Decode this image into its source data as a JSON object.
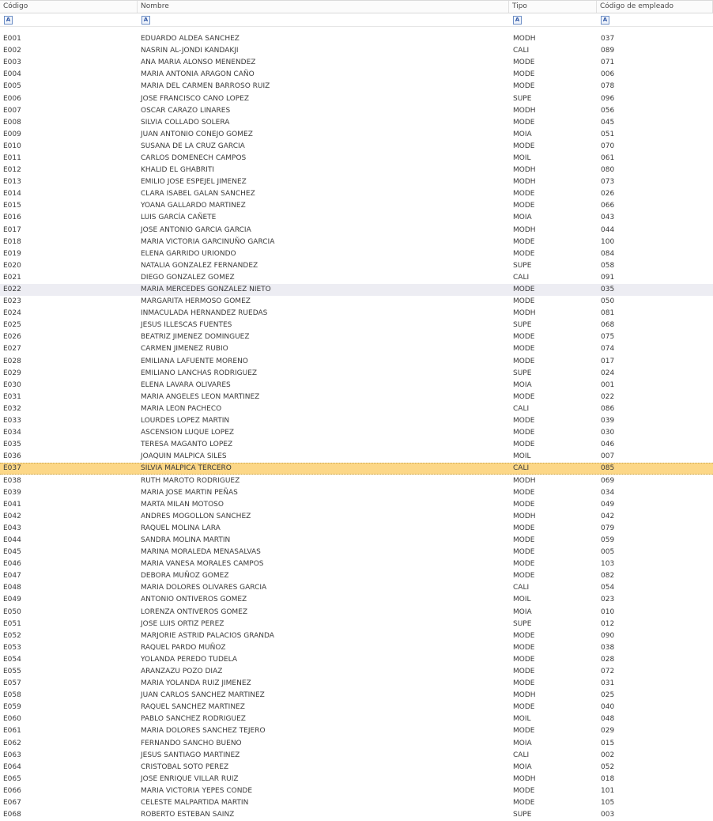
{
  "columns": {
    "codigo": "Código",
    "nombre": "Nombre",
    "tipo": "Tipo",
    "codigo_empleado": "Código de empleado"
  },
  "filter_icon_glyph": "A",
  "selected_codigo": "E037",
  "hover_codigo": "E022",
  "colors": {
    "selected_row": "#fcd787",
    "hover_row": "#ededf3",
    "filter_icon": "#2f56a4"
  },
  "rows": [
    {
      "codigo": "E001",
      "nombre": "EDUARDO ALDEA SANCHEZ",
      "tipo": "MODH",
      "emp": "037"
    },
    {
      "codigo": "E002",
      "nombre": "NASRIN AL-JONDI KANDAKJI",
      "tipo": "CALI",
      "emp": "089"
    },
    {
      "codigo": "E003",
      "nombre": "ANA MARIA ALONSO MENENDEZ",
      "tipo": "MODE",
      "emp": "071"
    },
    {
      "codigo": "E004",
      "nombre": "MARIA ANTONIA ARAGON CAÑO",
      "tipo": "MODE",
      "emp": "006"
    },
    {
      "codigo": "E005",
      "nombre": "MARIA DEL CARMEN BARROSO RUIZ",
      "tipo": "MODE",
      "emp": "078"
    },
    {
      "codigo": "E006",
      "nombre": "JOSE FRANCISCO CANO LOPEZ",
      "tipo": "SUPE",
      "emp": "096"
    },
    {
      "codigo": "E007",
      "nombre": "OSCAR CARAZO LINARES",
      "tipo": "MODH",
      "emp": "056"
    },
    {
      "codigo": "E008",
      "nombre": "SILVIA COLLADO SOLERA",
      "tipo": "MODE",
      "emp": "045"
    },
    {
      "codigo": "E009",
      "nombre": "JUAN ANTONIO CONEJO GOMEZ",
      "tipo": "MOIA",
      "emp": "051"
    },
    {
      "codigo": "E010",
      "nombre": "SUSANA DE LA CRUZ GARCIA",
      "tipo": "MODE",
      "emp": "070"
    },
    {
      "codigo": "E011",
      "nombre": "CARLOS DOMENECH CAMPOS",
      "tipo": "MOIL",
      "emp": "061"
    },
    {
      "codigo": "E012",
      "nombre": "KHALID EL GHABRITI",
      "tipo": "MODH",
      "emp": "080"
    },
    {
      "codigo": "E013",
      "nombre": "EMILIO JOSE ESPEJEL JIMENEZ",
      "tipo": "MODH",
      "emp": "073"
    },
    {
      "codigo": "E014",
      "nombre": "CLARA ISABEL GALAN SANCHEZ",
      "tipo": "MODE",
      "emp": "026"
    },
    {
      "codigo": "E015",
      "nombre": "YOANA GALLARDO MARTINEZ",
      "tipo": "MODE",
      "emp": "066"
    },
    {
      "codigo": "E016",
      "nombre": "LUIS GARCÍA CAÑETE",
      "tipo": "MOIA",
      "emp": "043"
    },
    {
      "codigo": "E017",
      "nombre": "JOSE ANTONIO GARCIA GARCIA",
      "tipo": "MODH",
      "emp": "044"
    },
    {
      "codigo": "E018",
      "nombre": "MARIA VICTORIA GARCINUÑO GARCIA",
      "tipo": "MODE",
      "emp": "100"
    },
    {
      "codigo": "E019",
      "nombre": "ELENA GARRIDO URIONDO",
      "tipo": "MODE",
      "emp": "084"
    },
    {
      "codigo": "E020",
      "nombre": "NATALIA GONZALEZ FERNANDEZ",
      "tipo": "SUPE",
      "emp": "058"
    },
    {
      "codigo": "E021",
      "nombre": "DIEGO GONZALEZ GOMEZ",
      "tipo": "CALI",
      "emp": "091"
    },
    {
      "codigo": "E022",
      "nombre": "MARIA MERCEDES GONZALEZ NIETO",
      "tipo": "MODE",
      "emp": "035"
    },
    {
      "codigo": "E023",
      "nombre": "MARGARITA HERMOSO GOMEZ",
      "tipo": "MODE",
      "emp": "050"
    },
    {
      "codigo": "E024",
      "nombre": "INMACULADA HERNANDEZ RUEDAS",
      "tipo": "MODH",
      "emp": "081"
    },
    {
      "codigo": "E025",
      "nombre": "JESUS ILLESCAS FUENTES",
      "tipo": "SUPE",
      "emp": "068"
    },
    {
      "codigo": "E026",
      "nombre": "BEATRIZ JIMENEZ DOMINGUEZ",
      "tipo": "MODE",
      "emp": "075"
    },
    {
      "codigo": "E027",
      "nombre": "CARMEN JIMENEZ RUBIO",
      "tipo": "MODE",
      "emp": "074"
    },
    {
      "codigo": "E028",
      "nombre": "EMILIANA LAFUENTE MORENO",
      "tipo": "MODE",
      "emp": "017"
    },
    {
      "codigo": "E029",
      "nombre": "EMILIANO LANCHAS RODRIGUEZ",
      "tipo": "SUPE",
      "emp": "024"
    },
    {
      "codigo": "E030",
      "nombre": "ELENA LAVARA OLIVARES",
      "tipo": "MOIA",
      "emp": "001"
    },
    {
      "codigo": "E031",
      "nombre": "MARIA ANGELES LEON MARTINEZ",
      "tipo": "MODE",
      "emp": "022"
    },
    {
      "codigo": "E032",
      "nombre": "MARIA LEON PACHECO",
      "tipo": "CALI",
      "emp": "086"
    },
    {
      "codigo": "E033",
      "nombre": "LOURDES LOPEZ MARTIN",
      "tipo": "MODE",
      "emp": "039"
    },
    {
      "codigo": "E034",
      "nombre": "ASCENSION LUQUE LOPEZ",
      "tipo": "MODE",
      "emp": "030"
    },
    {
      "codigo": "E035",
      "nombre": "TERESA MAGANTO LOPEZ",
      "tipo": "MODE",
      "emp": "046"
    },
    {
      "codigo": "E036",
      "nombre": "JOAQUIN MALPICA SILES",
      "tipo": "MOIL",
      "emp": "007"
    },
    {
      "codigo": "E037",
      "nombre": "SILVIA MALPICA TERCERO",
      "tipo": "CALI",
      "emp": "085"
    },
    {
      "codigo": "E038",
      "nombre": "RUTH MAROTO RODRIGUEZ",
      "tipo": "MODH",
      "emp": "069"
    },
    {
      "codigo": "E039",
      "nombre": "MARIA JOSE MARTIN PEÑAS",
      "tipo": "MODE",
      "emp": "034"
    },
    {
      "codigo": "E041",
      "nombre": "MARTA MILAN MOTOSO",
      "tipo": "MODE",
      "emp": "049"
    },
    {
      "codigo": "E042",
      "nombre": "ANDRES MOGOLLON SANCHEZ",
      "tipo": "MODH",
      "emp": "042"
    },
    {
      "codigo": "E043",
      "nombre": "RAQUEL MOLINA LARA",
      "tipo": "MODE",
      "emp": "079"
    },
    {
      "codigo": "E044",
      "nombre": "SANDRA MOLINA MARTIN",
      "tipo": "MODE",
      "emp": "059"
    },
    {
      "codigo": "E045",
      "nombre": "MARINA MORALEDA MENASALVAS",
      "tipo": "MODE",
      "emp": "005"
    },
    {
      "codigo": "E046",
      "nombre": "MARIA VANESA MORALES CAMPOS",
      "tipo": "MODE",
      "emp": "103"
    },
    {
      "codigo": "E047",
      "nombre": "DEBORA MUÑOZ GOMEZ",
      "tipo": "MODE",
      "emp": "082"
    },
    {
      "codigo": "E048",
      "nombre": "MARIA DOLORES OLIVARES GARCIA",
      "tipo": "CALI",
      "emp": "054"
    },
    {
      "codigo": "E049",
      "nombre": "ANTONIO ONTIVEROS GOMEZ",
      "tipo": "MOIL",
      "emp": "023"
    },
    {
      "codigo": "E050",
      "nombre": "LORENZA ONTIVEROS GOMEZ",
      "tipo": "MOIA",
      "emp": "010"
    },
    {
      "codigo": "E051",
      "nombre": "JOSE LUIS ORTIZ PEREZ",
      "tipo": "SUPE",
      "emp": "012"
    },
    {
      "codigo": "E052",
      "nombre": "MARJORIE ASTRID PALACIOS GRANDA",
      "tipo": "MODE",
      "emp": "090"
    },
    {
      "codigo": "E053",
      "nombre": "RAQUEL PARDO MUÑOZ",
      "tipo": "MODE",
      "emp": "038"
    },
    {
      "codigo": "E054",
      "nombre": "YOLANDA PEREDO TUDELA",
      "tipo": "MODE",
      "emp": "028"
    },
    {
      "codigo": "E055",
      "nombre": "ARANZAZU POZO DIAZ",
      "tipo": "MODE",
      "emp": "072"
    },
    {
      "codigo": "E057",
      "nombre": "MARIA YOLANDA RUIZ JIMENEZ",
      "tipo": "MODE",
      "emp": "031"
    },
    {
      "codigo": "E058",
      "nombre": "JUAN CARLOS SANCHEZ MARTINEZ",
      "tipo": "MODH",
      "emp": "025"
    },
    {
      "codigo": "E059",
      "nombre": "RAQUEL SANCHEZ MARTINEZ",
      "tipo": "MODE",
      "emp": "040"
    },
    {
      "codigo": "E060",
      "nombre": "PABLO SANCHEZ RODRIGUEZ",
      "tipo": "MOIL",
      "emp": "048"
    },
    {
      "codigo": "E061",
      "nombre": "MARIA DOLORES SANCHEZ TEJERO",
      "tipo": "MODE",
      "emp": "029"
    },
    {
      "codigo": "E062",
      "nombre": "FERNANDO SANCHO BUENO",
      "tipo": "MOIA",
      "emp": "015"
    },
    {
      "codigo": "E063",
      "nombre": "JESUS SANTIAGO MARTINEZ",
      "tipo": "CALI",
      "emp": "002"
    },
    {
      "codigo": "E064",
      "nombre": "CRISTOBAL SOTO PEREZ",
      "tipo": "MOIA",
      "emp": "052"
    },
    {
      "codigo": "E065",
      "nombre": "JOSE ENRIQUE VILLAR RUIZ",
      "tipo": "MODH",
      "emp": "018"
    },
    {
      "codigo": "E066",
      "nombre": "MARIA VICTORIA YEPES CONDE",
      "tipo": "MODE",
      "emp": "101"
    },
    {
      "codigo": "E067",
      "nombre": "CELESTE MALPARTIDA MARTIN",
      "tipo": "MODE",
      "emp": "105"
    },
    {
      "codigo": "E068",
      "nombre": "ROBERTO ESTEBAN SAINZ",
      "tipo": "SUPE",
      "emp": "003"
    }
  ]
}
